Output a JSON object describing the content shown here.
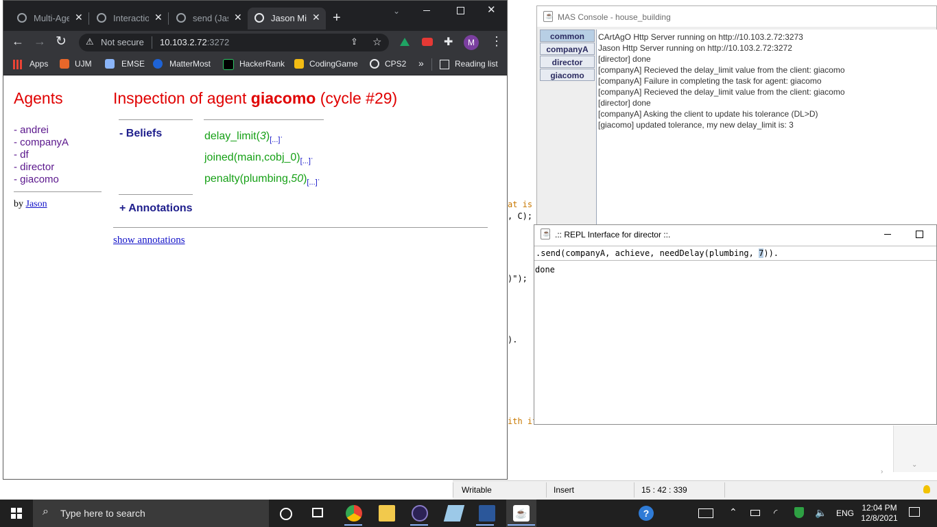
{
  "ide": {
    "code_fragments": [
      "at is h",
      ", C);",
      ")\");",
      ").",
      "ith it"
    ],
    "status": {
      "writable": "Writable",
      "insert": "Insert",
      "position": "15 : 42 : 339"
    }
  },
  "chrome": {
    "tabs": [
      {
        "label": "Multi-Agent"
      },
      {
        "label": "Interaction"
      },
      {
        "label": "send (Jason)"
      },
      {
        "label": "Jason Mind Inspector",
        "active": true
      }
    ],
    "new_tab": "+",
    "address": {
      "security": "Not secure",
      "host": "10.103.2.72",
      "port": ":3272"
    },
    "profile_initial": "M",
    "bookmarks": [
      {
        "label": "Apps",
        "color": "#e8eaed"
      },
      {
        "label": "UJM",
        "color": "#e8672a"
      },
      {
        "label": "EMSE",
        "color": "#8ab4f8"
      },
      {
        "label": "MatterMost",
        "color": "#1e63d6"
      },
      {
        "label": "HackerRank",
        "color": "#2ec866"
      },
      {
        "label": "CodingGame",
        "color": "#f2bb13"
      },
      {
        "label": "CPS2",
        "color": "#e8eaed"
      }
    ],
    "more_bookmarks": "»",
    "reading_list": "Reading list"
  },
  "jason": {
    "sidebar_title": "Agents",
    "agents": [
      "andrei",
      "companyA",
      "df",
      "director",
      "giacomo"
    ],
    "by_label": "by",
    "by_link": "Jason",
    "inspection": {
      "prefix": "Inspection of agent",
      "agent": "giacomo",
      "cycle": "(cycle #29)"
    },
    "beliefs_label": "- Beliefs",
    "beliefs": [
      {
        "functor": "delay_limit(",
        "arg": "3",
        "tail": ")"
      },
      {
        "functor": "joined(main,cobj_0)",
        "arg": "",
        "tail": ""
      },
      {
        "functor": "penalty(plumbing,",
        "arg": "50",
        "tail": ")"
      }
    ],
    "annot_link": "[...]",
    "annotations_label": "+ Annotations",
    "show_annotations": "show annotations"
  },
  "mas_console": {
    "title": "MAS Console - house_building",
    "tabs": [
      "common",
      "companyA",
      "director",
      "giacomo"
    ],
    "lines": [
      "CArtAgO Http Server running on http://10.103.2.72:3273",
      "Jason Http Server running on http://10.103.2.72:3272",
      "[director] done",
      "[companyA] Recieved the delay_limit value from the client: giacomo",
      "[companyA] Failure in completing the task for agent: giacomo",
      "[companyA] Recieved the delay_limit value from the client: giacomo",
      "[director] done",
      "[companyA] Asking the client to update his tolerance (DL>D)",
      "[giacomo] updated tolerance, my new delay_limit is: 3"
    ]
  },
  "repl": {
    "title": ".:: REPL Interface for director ::.",
    "input_before": ".send(companyA, achieve, needDelay(plumbing, ",
    "input_selected": "7",
    "input_after": ")).",
    "output": "done"
  },
  "taskbar": {
    "search_placeholder": "Type here to search",
    "language": "ENG",
    "time": "12:04 PM",
    "date": "12/8/2021"
  }
}
